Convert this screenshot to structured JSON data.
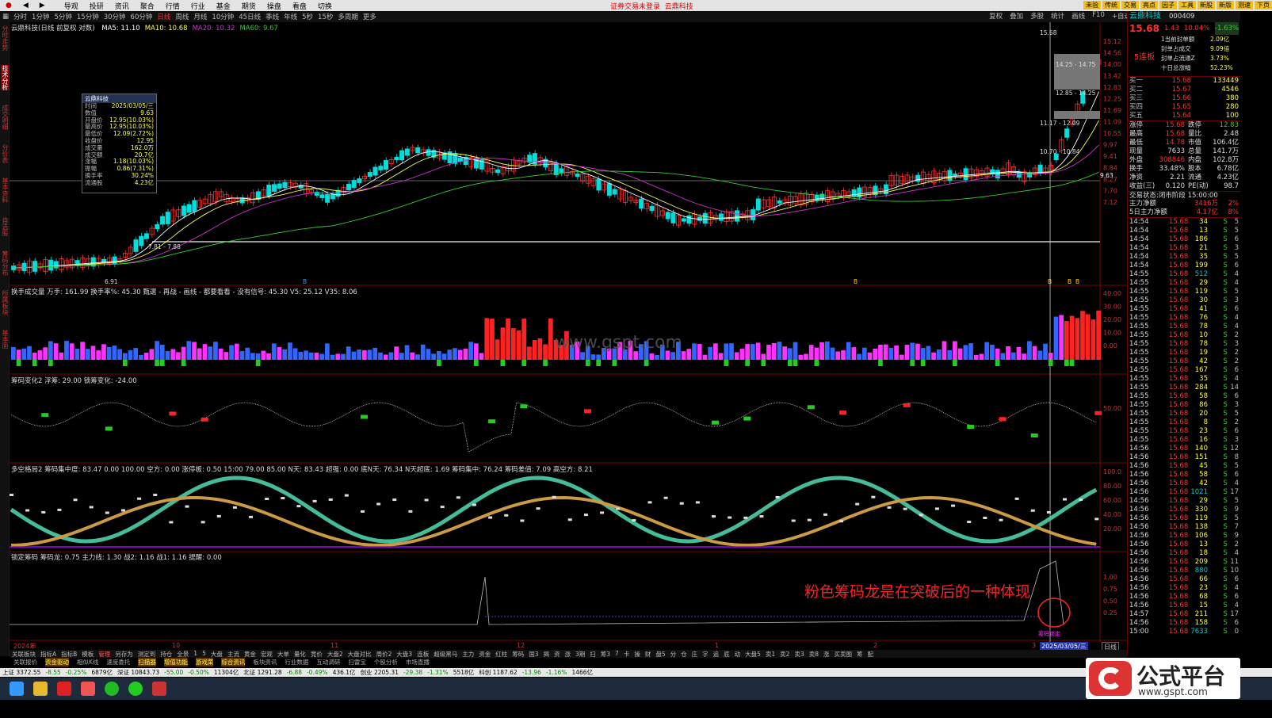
{
  "menubar": {
    "items": [
      "导观",
      "投研",
      "资讯",
      "聚合",
      "行情",
      "行业",
      "基金",
      "期货",
      "操盘",
      "看盘",
      "切换"
    ],
    "center_left": "证券交易未登录",
    "center_right": "云鼎科技",
    "right_buttons": [
      "未验",
      "传统",
      "交易",
      "亮点",
      "因子",
      "工具",
      "新股",
      "新版",
      "测速",
      "下页"
    ]
  },
  "periodbar": {
    "items": [
      "分时",
      "1分钟",
      "5分钟",
      "15分钟",
      "30分钟",
      "60分钟",
      "日线",
      "周线",
      "月线",
      "10分钟",
      "45日线",
      "季线",
      "年线",
      "5秒",
      "15秒",
      "多周期",
      "更多"
    ],
    "active": "日线",
    "right_tools": [
      "复权",
      "叠加",
      "多股",
      "统计",
      "画线",
      "F10",
      "+自选",
      "返回"
    ]
  },
  "left_strip": [
    "分时走势",
    "技术分析",
    "成交明细",
    "分价表",
    "基本资料",
    "自选股",
    "筹码分布",
    "所属板块",
    "基本面"
  ],
  "left_strip_selected": 1,
  "main_panel": {
    "title": "云鼎科技(日线 前复权 对数)",
    "ma": [
      {
        "label": "MA5: 11.10",
        "color": "#ffffff"
      },
      {
        "label": "MA10: 10.68",
        "color": "#ffff55"
      },
      {
        "label": "MA20: 10.32",
        "color": "#cc33cc"
      },
      {
        "label": "MA60: 9.67",
        "color": "#33cc33"
      }
    ],
    "price_ticks": [
      "15.12",
      "14.56",
      "14.00",
      "13.42",
      "12.83",
      "12.25",
      "11.69",
      "11.09",
      "10.55",
      "9.97",
      "9.41",
      "8.84",
      "8.27",
      "7.70",
      "7.12"
    ],
    "annotations": [
      "15.68",
      "14.25 - 14.75",
      "12.85 - 14.25",
      "11.17 - 12.09",
      "10.70 - 10.84",
      "7.81 - 7.88",
      "6.91",
      "9.63"
    ],
    "markers": [
      "B",
      "B",
      "B",
      "B",
      "B"
    ]
  },
  "infobox": {
    "title": "云鼎科技",
    "rows": [
      {
        "k": "时间",
        "v": "2025/03/05/三"
      },
      {
        "k": "数值",
        "v": "9.63"
      },
      {
        "k": "开盘价",
        "v": "12.95(10.03%)"
      },
      {
        "k": "最高价",
        "v": "12.95(10.03%)"
      },
      {
        "k": "最低价",
        "v": "12.09(2.72%)"
      },
      {
        "k": "收盘价",
        "v": "12.95"
      },
      {
        "k": "成交量",
        "v": "162.0万"
      },
      {
        "k": "成交额",
        "v": "20.7亿"
      },
      {
        "k": "涨幅",
        "v": "1.18(10.03%)"
      },
      {
        "k": "振幅",
        "v": "0.86(7.31%)"
      },
      {
        "k": "换手率",
        "v": "30.24%"
      },
      {
        "k": "流通股",
        "v": "4.23亿"
      }
    ]
  },
  "vol_panel": {
    "title": "换手成交量 万手: 161.99 换手率%: 45.30 甄選 - 再战 - 画线 - 都要看看 - 没有信号: 45.30  V5: 25.12  V35: 8.06",
    "ticks": [
      "40.00",
      "30.00",
      "20.00",
      "10.00",
      "0.00"
    ]
  },
  "chip_panel": {
    "title": "筹码变化2 浮筹: 29.00  锁筹变化: -24.00",
    "ticks": [
      "50.00"
    ]
  },
  "dk_panel": {
    "title": "多空格局2 筹码集中度: 83.47  0.00  100.00  空方: 0.00  涨停板: 0.50  15:00  79.00  85.00  N天: 83.43  超强: 0.00  底N天: 76.34  N天超底: 1.69  筹码集中: 76.24  筹码差值: 7.09  高空方: 8.21",
    "ticks": [
      "100.0",
      "80.00",
      "60.00",
      "40.00",
      "20.00"
    ]
  },
  "lock_panel": {
    "title": "锁定筹码 筹码龙: 0.75  主力线: 1.30  战2: 1.16  战1: 1.16  提醒: 0.00",
    "ticks": [
      "1.00",
      "0.75",
      "0.50",
      "0.25"
    ],
    "tag": "筹码锁定"
  },
  "time_axis": {
    "labels": [
      "2024年",
      "10",
      "11",
      "12",
      "1",
      "2",
      "3"
    ],
    "date_badge": "2025/03/05/三",
    "right_tag": "日线"
  },
  "annotation_text": "粉色筹码龙是在突破后的一种体现",
  "watermark": "www.gspt.com",
  "quote": {
    "name": "云鼎科技",
    "code": "000409",
    "price": "15.68",
    "change": "1.43",
    "pct": "10.04%",
    "pct2": "-1.63%",
    "badge": "5连板",
    "notes": [
      {
        "k": "1当前封单额",
        "v": "2.09亿"
      },
      {
        "k": "封单占成交",
        "v": "9.09倍"
      },
      {
        "k": "封单占流通Z",
        "v": "3.73%"
      },
      {
        "k": "十日总涨幅",
        "v": "52.23%"
      }
    ],
    "bids": [
      {
        "k": "买一",
        "p": "15.68",
        "v": "133449"
      },
      {
        "k": "买二",
        "p": "15.67",
        "v": "4546"
      },
      {
        "k": "买三",
        "p": "15.66",
        "v": "380"
      },
      {
        "k": "买四",
        "p": "15.65",
        "v": "280"
      },
      {
        "k": "买五",
        "p": "15.64",
        "v": "100"
      }
    ],
    "stats": [
      {
        "k1": "涨停",
        "v1": "15.68",
        "k2": "跌停",
        "v2": "12.83"
      },
      {
        "k1": "最高",
        "v1": "15.68",
        "k2": "量比",
        "v2": "2.48"
      },
      {
        "k1": "最低",
        "v1": "14.78",
        "k2": "市值",
        "v2": "106.4亿"
      },
      {
        "k1": "现量",
        "v1": "7633",
        "k2": "总量",
        "v2": "141.7万"
      },
      {
        "k1": "外盘",
        "v1": "308846",
        "k2": "内盘",
        "v2": "102.8万"
      },
      {
        "k1": "换手",
        "v1": "33.48%",
        "k2": "股本",
        "v2": "6.78亿"
      },
      {
        "k1": "净资",
        "v1": "2.21",
        "k2": "流通",
        "v2": "4.23亿"
      },
      {
        "k1": "收益(三)",
        "v1": "0.120",
        "k2": "PE(动)",
        "v2": "98.7"
      }
    ],
    "status": "交易状态:闭市阶段 15:00:00",
    "mainflow": [
      {
        "k": "主力净额",
        "v": "3416万",
        "p": "2%"
      },
      {
        "k": "5日主力净额",
        "v": "4.17亿",
        "p": "8%"
      }
    ],
    "ticks": [
      [
        "14:54",
        "15.68",
        "34",
        "S",
        "5"
      ],
      [
        "14:54",
        "15.68",
        "13",
        "S",
        "5"
      ],
      [
        "14:54",
        "15.68",
        "186",
        "S",
        "6"
      ],
      [
        "14:54",
        "15.68",
        "21",
        "S",
        "3"
      ],
      [
        "14:54",
        "15.68",
        "35",
        "S",
        "5"
      ],
      [
        "14:54",
        "15.68",
        "199",
        "S",
        "6"
      ],
      [
        "14:55",
        "15.68",
        "512",
        "S",
        "4"
      ],
      [
        "14:55",
        "15.68",
        "29",
        "S",
        "4"
      ],
      [
        "14:55",
        "15.68",
        "119",
        "S",
        "5"
      ],
      [
        "14:55",
        "15.68",
        "30",
        "S",
        "3"
      ],
      [
        "14:55",
        "15.68",
        "41",
        "S",
        "6"
      ],
      [
        "14:55",
        "15.68",
        "76",
        "S",
        "4"
      ],
      [
        "14:55",
        "15.68",
        "78",
        "S",
        "4"
      ],
      [
        "14:55",
        "15.68",
        "10",
        "S",
        "2"
      ],
      [
        "14:55",
        "15.68",
        "78",
        "S",
        "3"
      ],
      [
        "14:55",
        "15.68",
        "19",
        "S",
        "2"
      ],
      [
        "14:55",
        "15.68",
        "42",
        "S",
        "2"
      ],
      [
        "14:55",
        "15.68",
        "167",
        "S",
        "6"
      ],
      [
        "14:55",
        "15.68",
        "35",
        "S",
        "4"
      ],
      [
        "14:55",
        "15.68",
        "284",
        "S",
        "14"
      ],
      [
        "14:55",
        "15.68",
        "58",
        "S",
        "6"
      ],
      [
        "14:55",
        "15.68",
        "86",
        "S",
        "3"
      ],
      [
        "14:55",
        "15.68",
        "20",
        "S",
        "5"
      ],
      [
        "14:55",
        "15.68",
        "8",
        "S",
        "2"
      ],
      [
        "14:55",
        "15.68",
        "23",
        "S",
        "6"
      ],
      [
        "14:55",
        "15.68",
        "16",
        "S",
        "3"
      ],
      [
        "14:56",
        "15.68",
        "140",
        "S",
        "12"
      ],
      [
        "14:56",
        "15.68",
        "151",
        "S",
        "8"
      ],
      [
        "14:56",
        "15.68",
        "45",
        "S",
        "5"
      ],
      [
        "14:56",
        "15.68",
        "58",
        "S",
        "6"
      ],
      [
        "14:56",
        "15.68",
        "42",
        "S",
        "4"
      ],
      [
        "14:56",
        "15.68",
        "1021",
        "S",
        "17"
      ],
      [
        "14:56",
        "15.68",
        "29",
        "S",
        "5"
      ],
      [
        "14:56",
        "15.68",
        "330",
        "S",
        "9"
      ],
      [
        "14:56",
        "15.68",
        "119",
        "S",
        "5"
      ],
      [
        "14:56",
        "15.68",
        "138",
        "S",
        "7"
      ],
      [
        "14:56",
        "15.68",
        "106",
        "S",
        "9"
      ],
      [
        "14:56",
        "15.68",
        "13",
        "S",
        "2"
      ],
      [
        "14:56",
        "15.68",
        "18",
        "S",
        "4"
      ],
      [
        "14:56",
        "15.68",
        "209",
        "S",
        "11"
      ],
      [
        "14:56",
        "15.68",
        "880",
        "S",
        "10"
      ],
      [
        "14:56",
        "15.68",
        "66",
        "S",
        "6"
      ],
      [
        "14:56",
        "15.68",
        "23",
        "S",
        "4"
      ],
      [
        "14:56",
        "15.68",
        "68",
        "S",
        "6"
      ],
      [
        "14:56",
        "15.68",
        "15",
        "S",
        "4"
      ],
      [
        "14:57",
        "15.68",
        "211",
        "S",
        "17"
      ],
      [
        "14:56",
        "15.68",
        "158",
        "S",
        "6"
      ],
      [
        "15:00",
        "15.68",
        "7633",
        "S",
        "0"
      ]
    ]
  },
  "bottom_bar": [
    "关联板块",
    "指标A",
    "指标B",
    "模板",
    "管理",
    "另存为",
    "测定到",
    "持仓",
    "全景",
    "1",
    "5",
    "大盘",
    "主流",
    "黄金",
    "宏观",
    "大单",
    "量化",
    "竞价",
    "大盘2",
    "大盘对比",
    "周价2",
    "大盘3",
    "连板",
    "超级黑马",
    "主力",
    "资金",
    "红柱",
    "筹码",
    "国3",
    "揭",
    "资",
    "涨",
    "3期",
    "扫",
    "筹3",
    "7",
    "卡",
    "操",
    "财",
    "盘5",
    "分",
    "仓",
    "庄",
    "字",
    "追",
    "底",
    "动",
    "大盘5",
    "卖1",
    "卖2",
    "卖3",
    "卖8",
    "涨",
    "买卖图",
    "筹",
    "配"
  ],
  "bottom_bar2": [
    "关联报价",
    "资金驱动",
    "相似K线",
    "速度委托",
    "扫描器",
    "增值功能",
    "游戏菜",
    "综合资讯",
    "板块资讯",
    "行业数据",
    "互动调研",
    "扫雷宝",
    "个股分析",
    "市场直播"
  ],
  "bottom_bar2_hl": [
    1,
    4,
    5,
    6,
    7
  ],
  "statusbar": [
    "上证 3372.55",
    "-8.55",
    "-0.25%",
    "6879亿",
    "深证 10843.73",
    "-55.00",
    "-0.50%",
    "11304亿",
    "北证 1291.28",
    "-6.88",
    "-0.49%",
    "436.1亿",
    "创业 2205.31",
    "-29.38",
    "-1.31%",
    "5518亿",
    "科创 1187.62",
    "-13.96",
    "-1.16%",
    "1466亿"
  ],
  "logo": {
    "text": "公式平台",
    "url_text": "www.gspt.com"
  }
}
